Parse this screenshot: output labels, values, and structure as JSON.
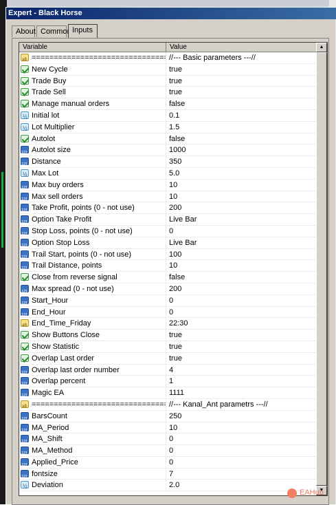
{
  "window": {
    "title": "Expert - Black Horse"
  },
  "tabs": [
    {
      "label": "About",
      "active": false
    },
    {
      "label": "Common",
      "active": false
    },
    {
      "label": "Inputs",
      "active": true
    }
  ],
  "grid": {
    "columns": {
      "variable": "Variable",
      "value": "Value"
    },
    "rows": [
      {
        "icon": "string-icon",
        "variable": "=======================================",
        "value": "//--- Basic parameters ---//"
      },
      {
        "icon": "bool-icon",
        "variable": "New Cycle",
        "value": "true"
      },
      {
        "icon": "bool-icon",
        "variable": "Trade Buy",
        "value": "true"
      },
      {
        "icon": "bool-icon",
        "variable": "Trade Sell",
        "value": "true"
      },
      {
        "icon": "bool-icon",
        "variable": "Manage manual orders",
        "value": "false"
      },
      {
        "icon": "double-icon",
        "variable": "Initial lot",
        "value": "0.1"
      },
      {
        "icon": "double-icon",
        "variable": "Lot Multiplier",
        "value": "1.5"
      },
      {
        "icon": "bool-icon",
        "variable": "Autolot",
        "value": "false"
      },
      {
        "icon": "int-icon",
        "variable": "Autolot size",
        "value": "1000"
      },
      {
        "icon": "int-icon",
        "variable": "Distance",
        "value": "350"
      },
      {
        "icon": "double-icon",
        "variable": "Max Lot",
        "value": "5.0"
      },
      {
        "icon": "int-icon",
        "variable": "Max buy orders",
        "value": "10"
      },
      {
        "icon": "int-icon",
        "variable": "Max sell orders",
        "value": "10"
      },
      {
        "icon": "int-icon",
        "variable": "Take Profit, points (0 - not use)",
        "value": "200"
      },
      {
        "icon": "int-icon",
        "variable": "Option Take Profit",
        "value": "Live Bar"
      },
      {
        "icon": "int-icon",
        "variable": "Stop Loss, points (0 - not use)",
        "value": "0"
      },
      {
        "icon": "int-icon",
        "variable": "Option Stop Loss",
        "value": "Live Bar"
      },
      {
        "icon": "int-icon",
        "variable": "Trail Start, points (0 - not use)",
        "value": "100"
      },
      {
        "icon": "int-icon",
        "variable": "Trail Distance, points",
        "value": "10"
      },
      {
        "icon": "bool-icon",
        "variable": "Close from reverse signal",
        "value": "false"
      },
      {
        "icon": "int-icon",
        "variable": "Max spread (0 - not use)",
        "value": "200"
      },
      {
        "icon": "int-icon",
        "variable": "Start_Hour",
        "value": "0"
      },
      {
        "icon": "int-icon",
        "variable": "End_Hour",
        "value": "0"
      },
      {
        "icon": "string-icon",
        "variable": "End_Time_Friday",
        "value": "22:30"
      },
      {
        "icon": "bool-icon",
        "variable": "Show Buttons Close",
        "value": "true"
      },
      {
        "icon": "bool-icon",
        "variable": "Show Statistic",
        "value": "true"
      },
      {
        "icon": "bool-icon",
        "variable": "Overlap Last order",
        "value": "true"
      },
      {
        "icon": "int-icon",
        "variable": "Overlap last order number",
        "value": "4"
      },
      {
        "icon": "int-icon",
        "variable": "Overlap percent",
        "value": "1"
      },
      {
        "icon": "int-icon",
        "variable": "Magic EA",
        "value": "1111"
      },
      {
        "icon": "string-icon",
        "variable": "=======================================",
        "value": "//--- Kanal_Ant parametrs ---//"
      },
      {
        "icon": "int-icon",
        "variable": "BarsCount",
        "value": "250"
      },
      {
        "icon": "int-icon",
        "variable": "MA_Period",
        "value": "10"
      },
      {
        "icon": "int-icon",
        "variable": "MA_Shift",
        "value": "0"
      },
      {
        "icon": "int-icon",
        "variable": "MA_Method",
        "value": "0"
      },
      {
        "icon": "int-icon",
        "variable": "Applied_Price",
        "value": "0"
      },
      {
        "icon": "int-icon",
        "variable": "fontsize",
        "value": "7"
      },
      {
        "icon": "double-icon",
        "variable": "Deviation",
        "value": "2.0"
      }
    ]
  },
  "watermark": {
    "text": "EAHub"
  },
  "colors": {
    "titlebar_start": "#0a246a",
    "titlebar_end": "#3a6ea5",
    "dialog_bg": "#d4d0c8",
    "grid_bg": "#ffffff"
  }
}
